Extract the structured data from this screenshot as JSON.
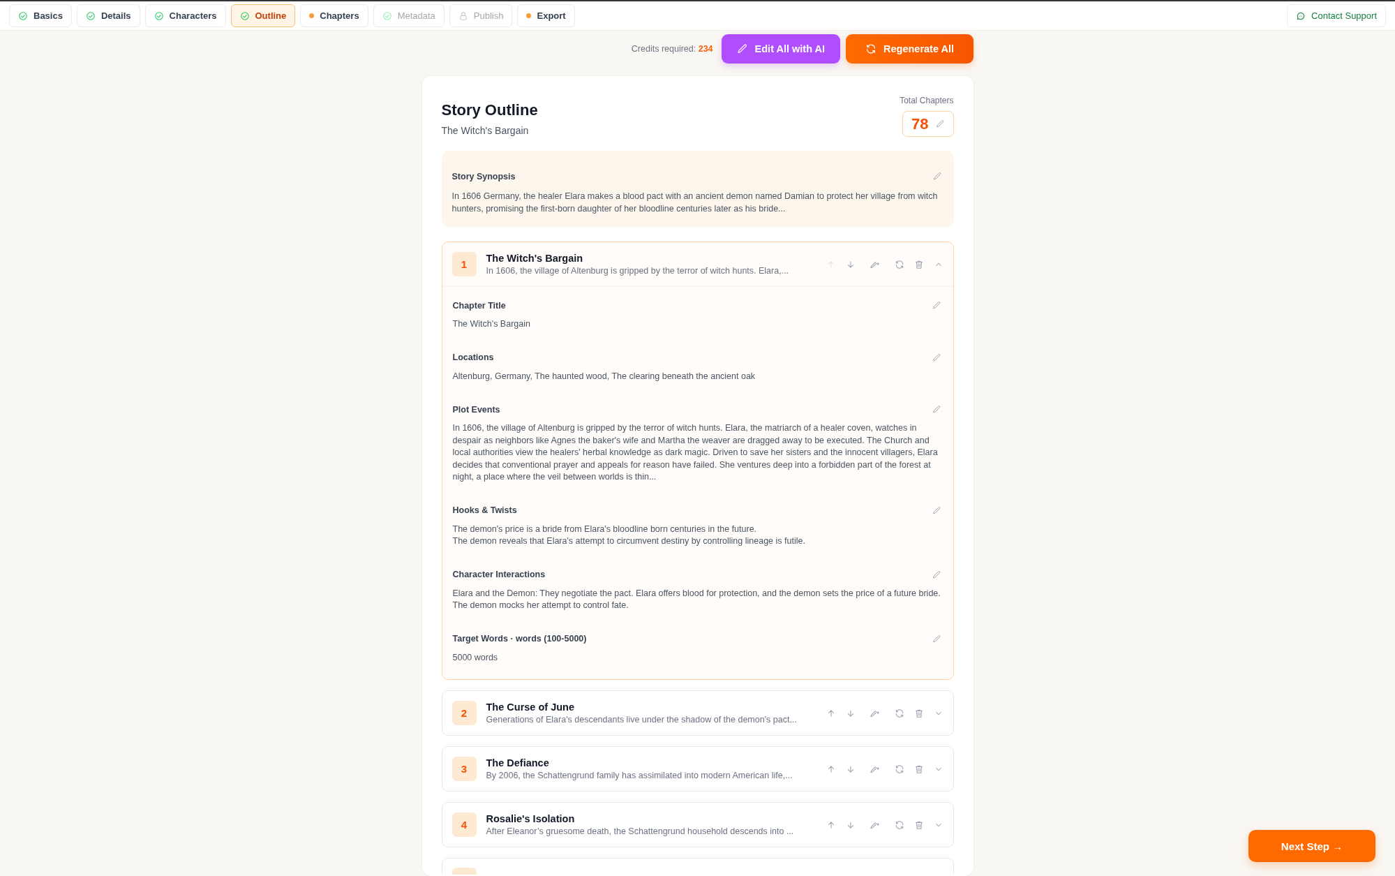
{
  "tabs": [
    {
      "label": "Basics",
      "kind": "done",
      "selected": false,
      "disabled": false
    },
    {
      "label": "Details",
      "kind": "done",
      "selected": false,
      "disabled": false
    },
    {
      "label": "Characters",
      "kind": "done",
      "selected": false,
      "disabled": false
    },
    {
      "label": "Outline",
      "kind": "done",
      "selected": true,
      "disabled": false
    },
    {
      "label": "Chapters",
      "kind": "pending",
      "selected": false,
      "disabled": false
    },
    {
      "label": "Metadata",
      "kind": "done",
      "selected": false,
      "disabled": true
    },
    {
      "label": "Publish",
      "kind": "locked",
      "selected": false,
      "disabled": true
    },
    {
      "label": "Export",
      "kind": "pending",
      "selected": false,
      "disabled": false
    }
  ],
  "support": {
    "label": "Contact Support"
  },
  "actions": {
    "credits_label": "Credits required:",
    "credits": "234",
    "buttons": [
      {
        "label": "Edit All with AI",
        "kind": "edit"
      },
      {
        "label": "Regenerate All",
        "kind": "regenerate"
      }
    ]
  },
  "outline": {
    "title": "Story Outline",
    "subtitle": "The Witch's Bargain",
    "total_label": "Total Chapters",
    "total": "78",
    "synopsis": {
      "label": "Story Synopsis",
      "text": "In 1606 Germany, the healer Elara makes a blood pact with an ancient demon named Damian to protect her village from witch hunters, promising the first-born daughter of her bloodline centuries later as his bride..."
    },
    "chapters": [
      {
        "number": "1",
        "title": "The Witch's Bargain",
        "summary": "In 1606, the village of Altenburg is gripped by the terror of witch hunts. Elara,...",
        "expanded": true,
        "up_disabled": true,
        "fields": [
          {
            "label": "Chapter Title",
            "lines": [
              "The Witch's Bargain"
            ]
          },
          {
            "label": "Locations",
            "lines": [
              "Altenburg, Germany, The haunted wood, The clearing beneath the ancient oak"
            ]
          },
          {
            "label": "Plot Events",
            "lines": [
              "In 1606, the village of Altenburg is gripped by the terror of witch hunts. Elara, the matriarch of a healer coven, watches in despair as neighbors like Agnes the baker's wife and Martha the weaver are dragged away to be executed. The Church and local authorities view the healers' herbal knowledge as dark magic. Driven to save her sisters and the innocent villagers, Elara decides that conventional prayer and appeals for reason have failed. She ventures deep into a forbidden part of the forest at night, a place where the veil between worlds is thin..."
            ]
          },
          {
            "label": "Hooks & Twists",
            "lines": [
              "The demon's price is a bride from Elara's bloodline born centuries in the future.",
              "The demon reveals that Elara's attempt to circumvent destiny by controlling lineage is futile."
            ]
          },
          {
            "label": "Character Interactions",
            "lines": [
              "Elara and the Demon: They negotiate the pact. Elara offers blood for protection, and the demon sets the price of a future bride. The demon mocks her attempt to control fate."
            ]
          },
          {
            "label": "Target Words · words (100-5000)",
            "lines": [
              "5000 words"
            ]
          }
        ]
      },
      {
        "number": "2",
        "title": "The Curse of June",
        "summary": "Generations of Elara's descendants live under the shadow of the demon's pact...",
        "expanded": false,
        "up_disabled": false
      },
      {
        "number": "3",
        "title": "The Defiance",
        "summary": "By 2006, the Schattengrund family has assimilated into modern American life,...",
        "expanded": false,
        "up_disabled": false
      },
      {
        "number": "4",
        "title": "Rosalie's Isolation",
        "summary": "After Eleanor’s gruesome death, the Schattengrund household descends into ...",
        "expanded": false,
        "up_disabled": false
      }
    ],
    "more_below": true
  },
  "next": {
    "label": "Next Step →"
  }
}
